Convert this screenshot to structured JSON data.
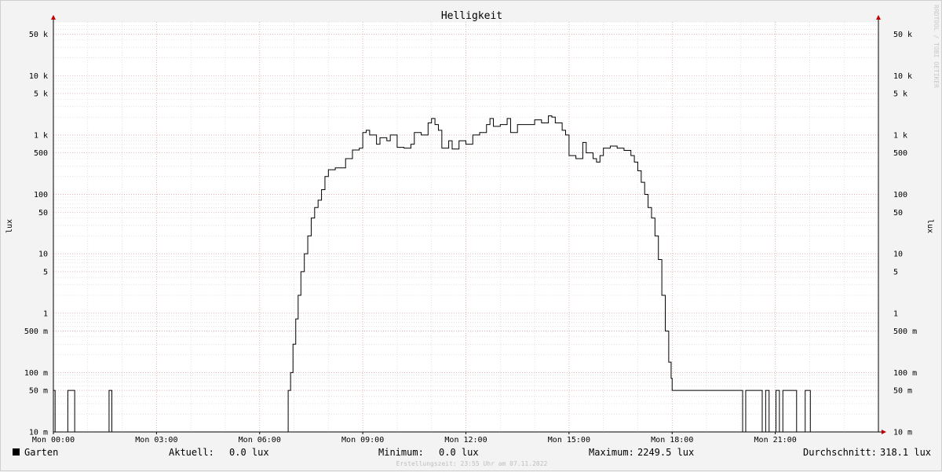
{
  "chart_data": {
    "type": "line",
    "title": "Helligkeit",
    "ylabel": "lux",
    "ylabel_right": "lux",
    "watermark": "RRDTOOL / TOBI OETIKER",
    "y_scale": "log",
    "ylim": [
      0.01,
      80000
    ],
    "xlim": [
      0,
      24
    ],
    "y_ticks": [
      {
        "value": 50000,
        "label": "50 k"
      },
      {
        "value": 10000,
        "label": "10 k"
      },
      {
        "value": 5000,
        "label": "5 k"
      },
      {
        "value": 1000,
        "label": "1 k"
      },
      {
        "value": 500,
        "label": "500"
      },
      {
        "value": 100,
        "label": "100"
      },
      {
        "value": 50,
        "label": "50"
      },
      {
        "value": 10,
        "label": "10"
      },
      {
        "value": 5,
        "label": "5"
      },
      {
        "value": 1,
        "label": "1"
      },
      {
        "value": 0.5,
        "label": "500 m"
      },
      {
        "value": 0.1,
        "label": "100 m"
      },
      {
        "value": 0.05,
        "label": "50 m"
      },
      {
        "value": 0.01,
        "label": "10 m"
      }
    ],
    "x_ticks": [
      {
        "value": 0,
        "label": "Mon 00:00"
      },
      {
        "value": 3,
        "label": "Mon 03:00"
      },
      {
        "value": 6,
        "label": "Mon 06:00"
      },
      {
        "value": 9,
        "label": "Mon 09:00"
      },
      {
        "value": 12,
        "label": "Mon 12:00"
      },
      {
        "value": 15,
        "label": "Mon 15:00"
      },
      {
        "value": 18,
        "label": "Mon 18:00"
      },
      {
        "value": 21,
        "label": "Mon 21:00"
      }
    ],
    "grid": true,
    "legend_position": "bottom-left",
    "series": [
      {
        "name": "Garten",
        "color": "#000000",
        "points": [
          [
            0,
            0.05
          ],
          [
            0.05,
            0.01
          ],
          [
            0.4,
            0.01
          ],
          [
            0.42,
            0.05
          ],
          [
            0.6,
            0.05
          ],
          [
            0.62,
            0.01
          ],
          [
            1.6,
            0.01
          ],
          [
            1.62,
            0.05
          ],
          [
            1.68,
            0.05
          ],
          [
            1.7,
            0.01
          ],
          [
            6.8,
            0.01
          ],
          [
            6.83,
            0.05
          ],
          [
            6.9,
            0.1
          ],
          [
            6.97,
            0.3
          ],
          [
            7.05,
            0.8
          ],
          [
            7.12,
            2
          ],
          [
            7.2,
            5
          ],
          [
            7.3,
            10
          ],
          [
            7.4,
            20
          ],
          [
            7.5,
            40
          ],
          [
            7.6,
            60
          ],
          [
            7.7,
            80
          ],
          [
            7.8,
            120
          ],
          [
            7.9,
            200
          ],
          [
            8.0,
            260
          ],
          [
            8.2,
            280
          ],
          [
            8.4,
            280
          ],
          [
            8.5,
            400
          ],
          [
            8.7,
            560
          ],
          [
            8.9,
            600
          ],
          [
            9.0,
            1100
          ],
          [
            9.1,
            1200
          ],
          [
            9.2,
            1000
          ],
          [
            9.4,
            700
          ],
          [
            9.5,
            900
          ],
          [
            9.7,
            800
          ],
          [
            9.8,
            1000
          ],
          [
            10.0,
            620
          ],
          [
            10.2,
            600
          ],
          [
            10.4,
            700
          ],
          [
            10.5,
            1100
          ],
          [
            10.7,
            1000
          ],
          [
            10.9,
            1600
          ],
          [
            11.0,
            1900
          ],
          [
            11.1,
            1500
          ],
          [
            11.2,
            1200
          ],
          [
            11.3,
            600
          ],
          [
            11.5,
            800
          ],
          [
            11.6,
            580
          ],
          [
            11.8,
            800
          ],
          [
            12.0,
            700
          ],
          [
            12.2,
            1000
          ],
          [
            12.4,
            1100
          ],
          [
            12.6,
            1500
          ],
          [
            12.7,
            1900
          ],
          [
            12.8,
            1400
          ],
          [
            13.0,
            1500
          ],
          [
            13.2,
            1900
          ],
          [
            13.3,
            1100
          ],
          [
            13.5,
            1500
          ],
          [
            13.8,
            1500
          ],
          [
            14.0,
            1800
          ],
          [
            14.2,
            1600
          ],
          [
            14.4,
            2100
          ],
          [
            14.5,
            2000
          ],
          [
            14.6,
            1600
          ],
          [
            14.8,
            1200
          ],
          [
            14.9,
            1000
          ],
          [
            15.0,
            450
          ],
          [
            15.2,
            400
          ],
          [
            15.4,
            750
          ],
          [
            15.5,
            500
          ],
          [
            15.7,
            400
          ],
          [
            15.8,
            350
          ],
          [
            15.9,
            450
          ],
          [
            16.0,
            600
          ],
          [
            16.2,
            650
          ],
          [
            16.4,
            600
          ],
          [
            16.6,
            550
          ],
          [
            16.8,
            450
          ],
          [
            16.9,
            350
          ],
          [
            17.0,
            250
          ],
          [
            17.1,
            160
          ],
          [
            17.2,
            100
          ],
          [
            17.3,
            60
          ],
          [
            17.4,
            40
          ],
          [
            17.5,
            20
          ],
          [
            17.6,
            8
          ],
          [
            17.7,
            2
          ],
          [
            17.8,
            0.5
          ],
          [
            17.9,
            0.15
          ],
          [
            17.97,
            0.08
          ],
          [
            18.0,
            0.05
          ],
          [
            20.0,
            0.05
          ],
          [
            20.05,
            0.01
          ],
          [
            20.12,
            0.01
          ],
          [
            20.14,
            0.05
          ],
          [
            20.6,
            0.05
          ],
          [
            20.62,
            0.01
          ],
          [
            20.7,
            0.01
          ],
          [
            20.72,
            0.05
          ],
          [
            20.8,
            0.05
          ],
          [
            20.82,
            0.01
          ],
          [
            21.0,
            0.01
          ],
          [
            21.02,
            0.05
          ],
          [
            21.1,
            0.05
          ],
          [
            21.12,
            0.01
          ],
          [
            21.2,
            0.01
          ],
          [
            21.22,
            0.05
          ],
          [
            21.6,
            0.05
          ],
          [
            21.62,
            0.01
          ],
          [
            21.85,
            0.01
          ],
          [
            21.87,
            0.05
          ],
          [
            22.0,
            0.05
          ],
          [
            22.02,
            0.01
          ],
          [
            24.0,
            0.01
          ]
        ]
      }
    ],
    "legend": {
      "series_name": "Garten",
      "swatch_color": "#000000",
      "aktuell_label": "Aktuell:",
      "aktuell_value": "0.0 lux",
      "minimum_label": "Minimum:",
      "minimum_value": "0.0 lux",
      "maximum_label": "Maximum:",
      "maximum_value": "2249.5 lux",
      "durchschnitt_label": "Durchschnitt:",
      "durchschnitt_value": "318.1 lux"
    },
    "footer": "Erstellungszeit: 23:55 Uhr am 07.11.2022",
    "colors": {
      "background": "#f3f3f3",
      "plot_background": "#ffffff",
      "major_grid": "#e0a0a0",
      "minor_grid": "#d0d0d0",
      "axis": "#000000",
      "arrow": "#c00000"
    }
  }
}
